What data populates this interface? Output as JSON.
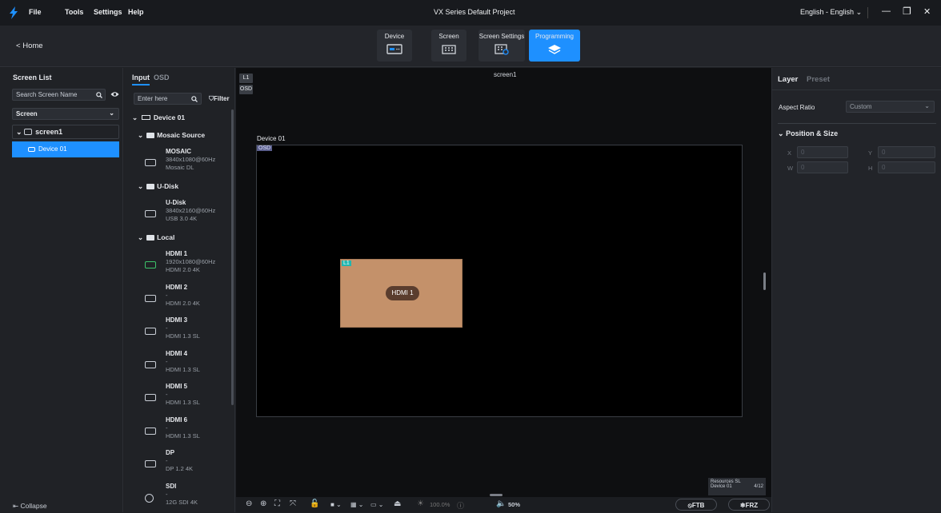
{
  "titlebar": {
    "menu": [
      "File",
      "Tools",
      "Settings",
      "Help"
    ],
    "project_title": "VX Series Default Project",
    "language": "English - English",
    "minimize": "—",
    "restore": "❐",
    "close": "✕"
  },
  "toolbar": {
    "home_label": "Home",
    "tabs": [
      {
        "label": "Device",
        "icon": "device-icon"
      },
      {
        "label": "Screen",
        "icon": "screen-icon"
      },
      {
        "label": "Screen Settings",
        "icon": "screen-settings-icon"
      },
      {
        "label": "Programming",
        "icon": "layers-icon",
        "active": true
      }
    ]
  },
  "screen_list": {
    "title": "Screen List",
    "search_placeholder": "Search Screen Name",
    "filter_select": "Screen",
    "tree": {
      "screen_name": "screen1",
      "device_name": "Device 01"
    },
    "collapse_label": "Collapse"
  },
  "input_panel": {
    "tabs": [
      "Input",
      "OSD"
    ],
    "search_placeholder": "Enter here",
    "filter_label": "Filter",
    "device": "Device 01",
    "groups": [
      {
        "name": "Mosaic Source",
        "items": [
          {
            "name": "MOSAIC",
            "res": "3840x1080@60Hz",
            "type": "Mosaic DL"
          }
        ]
      },
      {
        "name": "U-Disk",
        "items": [
          {
            "name": "U-Disk",
            "res": "3840x2160@60Hz",
            "type": "USB 3.0 4K"
          }
        ]
      },
      {
        "name": "Local",
        "items": [
          {
            "name": "HDMI 1",
            "res": "1920x1080@60Hz",
            "type": "HDMI 2.0 4K",
            "active": true
          },
          {
            "name": "HDMI 2",
            "res": "-",
            "type": "HDMI 2.0 4K"
          },
          {
            "name": "HDMI 3",
            "res": "-",
            "type": "HDMI 1.3 SL"
          },
          {
            "name": "HDMI 4",
            "res": "-",
            "type": "HDMI 1.3 SL"
          },
          {
            "name": "HDMI 5",
            "res": "-",
            "type": "HDMI 1.3 SL"
          },
          {
            "name": "HDMI 6",
            "res": "-",
            "type": "HDMI 1.3 SL"
          },
          {
            "name": "DP",
            "res": "-",
            "type": "DP 1.2 4K"
          },
          {
            "name": "SDI",
            "res": "-",
            "type": "12G SDI 4K"
          }
        ]
      }
    ]
  },
  "canvas": {
    "screen_title": "screen1",
    "layer_buttons": [
      "L1",
      "OSD"
    ],
    "device_label": "Device 01",
    "osd_tag": "OSD",
    "layer_tag": "L1",
    "layer_source": "HDMI 1",
    "layer_color": "#c4916a",
    "resources_title": "Resources SL",
    "resources_device": "Device 01",
    "resources_count": "4/12"
  },
  "bottombar": {
    "brightness": "100.0%",
    "volume": "50%",
    "ftb": "FTB",
    "frz": "FRZ"
  },
  "right_panel": {
    "tabs": [
      "Layer",
      "Preset"
    ],
    "aspect_label": "Aspect Ratio",
    "aspect_value": "Custom",
    "section": "Position & Size",
    "x_label": "X",
    "x_value": "0",
    "y_label": "Y",
    "y_value": "0",
    "w_label": "W",
    "w_value": "0",
    "h_label": "H",
    "h_value": "0"
  },
  "colors": {
    "accent": "#1e90ff",
    "bg": "#1e2024"
  }
}
